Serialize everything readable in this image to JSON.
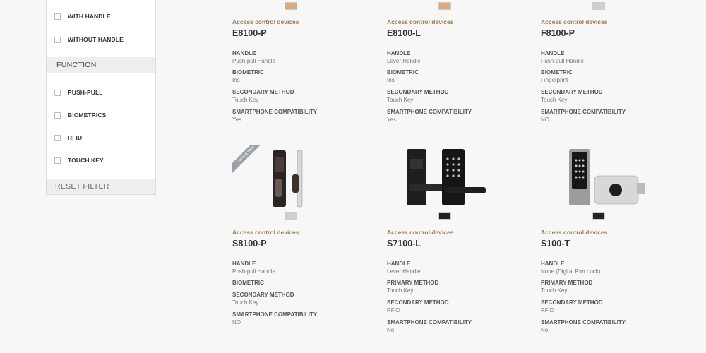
{
  "sidebar": {
    "handle_options": [
      {
        "label": "WITH HANDLE"
      },
      {
        "label": "WITHOUT HANDLE"
      }
    ],
    "function_title": "FUNCTION",
    "function_options": [
      {
        "label": "PUSH-PULL"
      },
      {
        "label": "BIOMETRICS"
      },
      {
        "label": "RFID"
      },
      {
        "label": "TOUCH KEY"
      }
    ],
    "reset_label": "RESET FILTER"
  },
  "products": [
    {
      "category": "Access control devices",
      "model": "E8100-P",
      "swatch_colors": [
        "#d9ac80"
      ],
      "specs": [
        {
          "key": "HANDLE",
          "value": "Push-pull Handle"
        },
        {
          "key": "BIOMETRIC",
          "value": "Iris"
        },
        {
          "key": "SECONDARY METHOD",
          "value": "Touch Key"
        },
        {
          "key": "SMARTPHONE COMPATIBILITY",
          "value": "Yes"
        }
      ]
    },
    {
      "category": "Access control devices",
      "model": "E8100-L",
      "swatch_colors": [
        "#d9ac80"
      ],
      "specs": [
        {
          "key": "HANDLE",
          "value": "Lever Handle"
        },
        {
          "key": "BIOMETRIC",
          "value": "Iris"
        },
        {
          "key": "SECONDARY METHOD",
          "value": "Touch Key"
        },
        {
          "key": "SMARTPHONE COMPATIBILITY",
          "value": "Yes"
        }
      ]
    },
    {
      "category": "Access control devices",
      "model": "F8100-P",
      "swatch_colors": [
        "#cfcfcf"
      ],
      "specs": [
        {
          "key": "HANDLE",
          "value": "Push-pull Handle"
        },
        {
          "key": "BIOMETRIC",
          "value": "Fingerprint"
        },
        {
          "key": "SECONDARY METHOD",
          "value": "Touch Key"
        },
        {
          "key": "SMARTPHONE COMPATIBILITY",
          "value": "NO"
        }
      ]
    },
    {
      "category": "Access control devices",
      "model": "S8100-P",
      "ribbon": "Coming soon",
      "swatch_colors": [
        "#cfcfcf"
      ],
      "specs": [
        {
          "key": "HANDLE",
          "value": "Push-pull Handle"
        },
        {
          "key": "BIOMETRIC",
          "value": ""
        },
        {
          "key": "SECONDARY METHOD",
          "value": "Touch Key"
        },
        {
          "key": "SMARTPHONE COMPATIBILITY",
          "value": "NO"
        }
      ]
    },
    {
      "category": "Access control devices",
      "model": "S7100-L",
      "swatch_colors": [
        "#222222"
      ],
      "specs": [
        {
          "key": "HANDLE",
          "value": "Lever Handle"
        },
        {
          "key": "PRIMARY METHOD",
          "value": "Touch Key"
        },
        {
          "key": "SECONDARY METHOD",
          "value": "RFID"
        },
        {
          "key": "SMARTPHONE COMPATIBILITY",
          "value": "No"
        }
      ]
    },
    {
      "category": "Access control devices",
      "model": "S100-T",
      "swatch_colors": [
        "#222222"
      ],
      "specs": [
        {
          "key": "HANDLE",
          "value": "None (Digital Rim Lock)"
        },
        {
          "key": "PRIMARY METHOD",
          "value": "Touch Key"
        },
        {
          "key": "SECONDARY METHOD",
          "value": "RFID"
        },
        {
          "key": "SMARTPHONE COMPATIBILITY",
          "value": "No"
        }
      ]
    }
  ]
}
